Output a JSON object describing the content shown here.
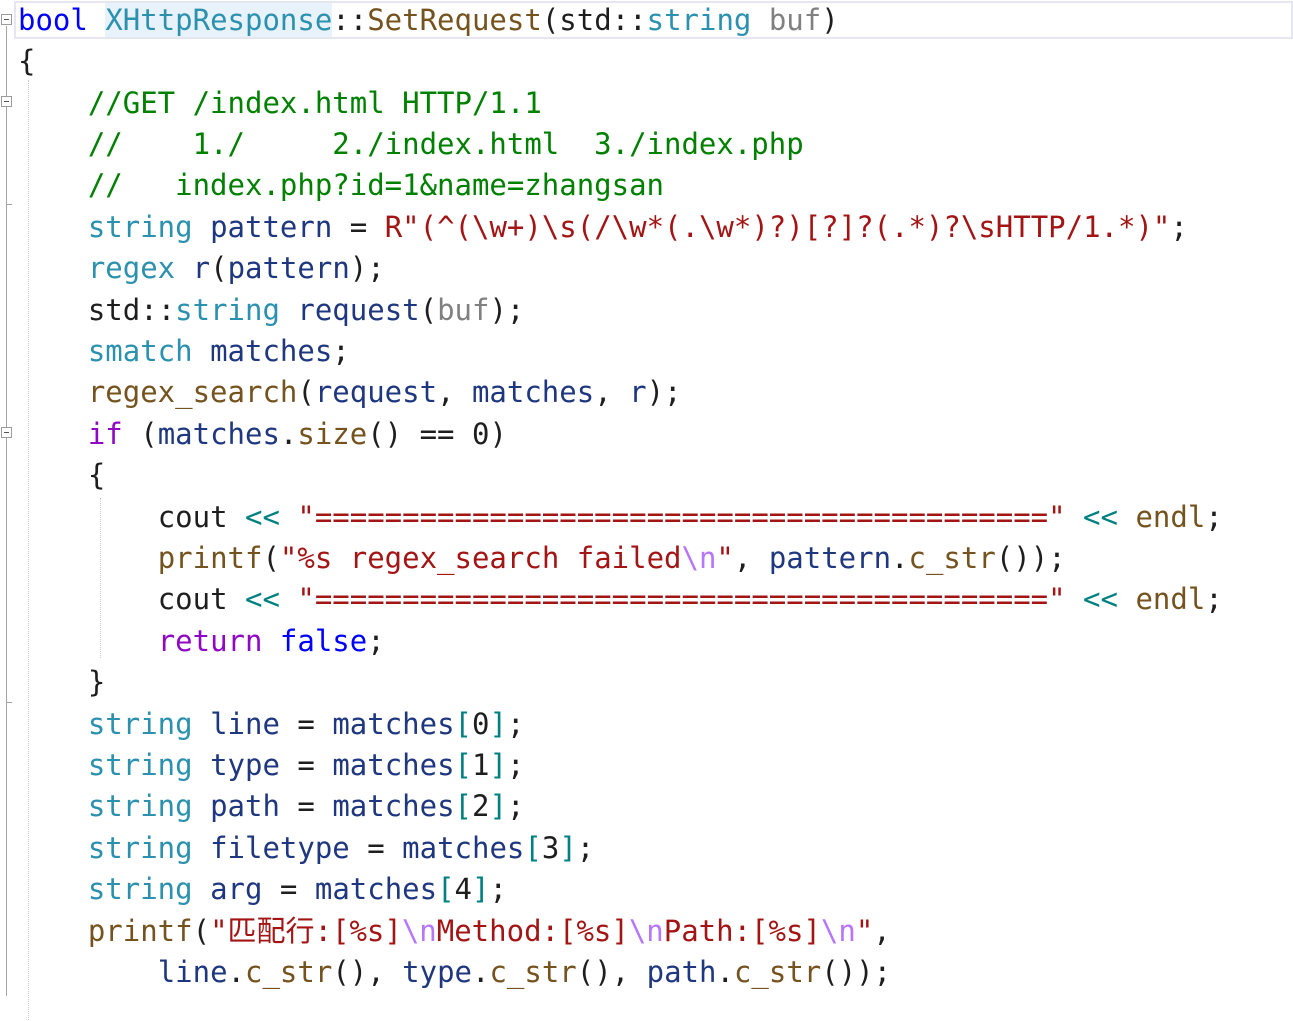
{
  "editor": {
    "signature": {
      "ret": "bool",
      "cls": "XHttpResponse",
      "scope": "::",
      "fn": "SetRequest",
      "open": "(",
      "ns": "std",
      "ns_sep": "::",
      "ptype": "string",
      "pname": "buf",
      "close": ")"
    },
    "body": {
      "open_brace": "{",
      "comment1": "//GET /index.html HTTP/1.1",
      "comment2": "//    1./     2./index.html  3./index.php",
      "comment3": "//   index.php?id=1&name=zhangsan",
      "pattern_decl": {
        "type": "string",
        "name": "pattern",
        "eq": " = ",
        "literal": "R\"(^(\\w+)\\s(/\\w*(.\\w*)?)[?]?(.*)?\\sHTTP/1.*)\"",
        "end": ";"
      },
      "regex_decl": {
        "type": "regex",
        "name": "r",
        "open": "(",
        "arg": "pattern",
        "close": ");"
      },
      "request_decl": {
        "ns": "std",
        "ns_sep": "::",
        "type": "string",
        "name": "request",
        "open": "(",
        "arg": "buf",
        "close": ");"
      },
      "smatch_decl": {
        "type": "smatch",
        "name": "matches",
        "end": ";"
      },
      "search_call": {
        "fn": "regex_search",
        "open": "(",
        "a1": "request",
        "sep1": ", ",
        "a2": "matches",
        "sep2": ", ",
        "a3": "r",
        "close": ");"
      },
      "if_stmt": {
        "kw": "if",
        "open": " (",
        "obj": "matches",
        "dot": ".",
        "method": "size",
        "call": "()",
        "op": " == ",
        "num": "0",
        "close": ")"
      },
      "if_open_brace": "{",
      "cout1": {
        "name": "cout",
        "op1": " << ",
        "str": "\"==========================================\"",
        "op2": " << ",
        "endl": "endl",
        "end": ";"
      },
      "printf1": {
        "fn": "printf",
        "open": "(",
        "str_a": "\"%s regex_search failed",
        "esc": "\\n",
        "str_b": "\"",
        "sep": ", ",
        "obj": "pattern",
        "dot": ".",
        "method": "c_str",
        "close": "());"
      },
      "cout2": {
        "name": "cout",
        "op1": " << ",
        "str": "\"==========================================\"",
        "op2": " << ",
        "endl": "endl",
        "end": ";"
      },
      "return_stmt": {
        "kw": "return",
        "sp": " ",
        "val": "false",
        "end": ";"
      },
      "if_close_brace": "}",
      "assign": [
        {
          "type": "string",
          "name": "line",
          "eq": " = ",
          "obj": "matches",
          "lb": "[",
          "idx": "0",
          "rb": "]",
          "end": ";"
        },
        {
          "type": "string",
          "name": "type",
          "eq": " = ",
          "obj": "matches",
          "lb": "[",
          "idx": "1",
          "rb": "]",
          "end": ";"
        },
        {
          "type": "string",
          "name": "path",
          "eq": " = ",
          "obj": "matches",
          "lb": "[",
          "idx": "2",
          "rb": "]",
          "end": ";"
        },
        {
          "type": "string",
          "name": "filetype",
          "eq": " = ",
          "obj": "matches",
          "lb": "[",
          "idx": "3",
          "rb": "]",
          "end": ";"
        },
        {
          "type": "string",
          "name": "arg",
          "eq": " = ",
          "obj": "matches",
          "lb": "[",
          "idx": "4",
          "rb": "]",
          "end": ";"
        }
      ],
      "printf2": {
        "fn": "printf",
        "open": "(",
        "s1": "\"匹配行:[%s]",
        "e1": "\\n",
        "s2": "Method:[%s]",
        "e2": "\\n",
        "s3": "Path:[%s]",
        "e3": "\\n",
        "s4": "\"",
        "end": ","
      },
      "printf2_args": {
        "v1": "line",
        "d1": ".",
        "m1": "c_str",
        "c1": "(), ",
        "v2": "type",
        "d2": ".",
        "m2": "c_str",
        "c2": "(), ",
        "v3": "path",
        "d3": ".",
        "m3": "c_str",
        "c3": "());"
      }
    }
  },
  "colors": {
    "keyword": "#0000ff",
    "control": "#8f08c4",
    "type": "#2b91af",
    "function": "#74531f",
    "variable": "#1f377f",
    "parameter": "#808080",
    "string": "#a31515",
    "escape": "#b776fb",
    "comment": "#008000",
    "operator": "#008080"
  },
  "icons": {
    "fold": "fold-collapse-icon"
  }
}
